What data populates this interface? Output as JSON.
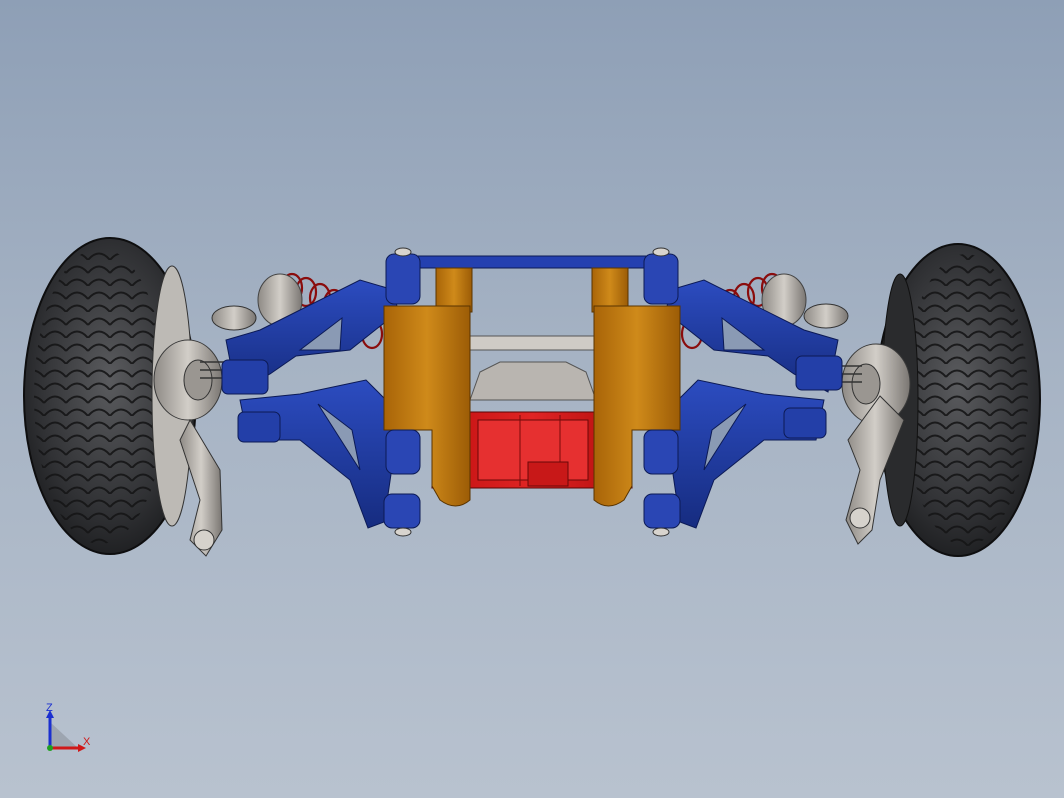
{
  "viewport": {
    "triad": {
      "z_label": "Z",
      "x_label": "X"
    },
    "colors": {
      "background_top": "#8e9fb6",
      "background_bottom": "#b8c2cf",
      "tire": "#2e2f31",
      "wheel_hub": "#b7b3ae",
      "control_arm": "#1f3a9a",
      "shock_tower": "#c27a12",
      "chassis_block": "#d01818",
      "spring": "#a01010",
      "axis_z": "#1a2fd0",
      "axis_x": "#d01818",
      "axis_y": "#20a020"
    },
    "icons": [
      "coordinate-triad-icon"
    ]
  }
}
